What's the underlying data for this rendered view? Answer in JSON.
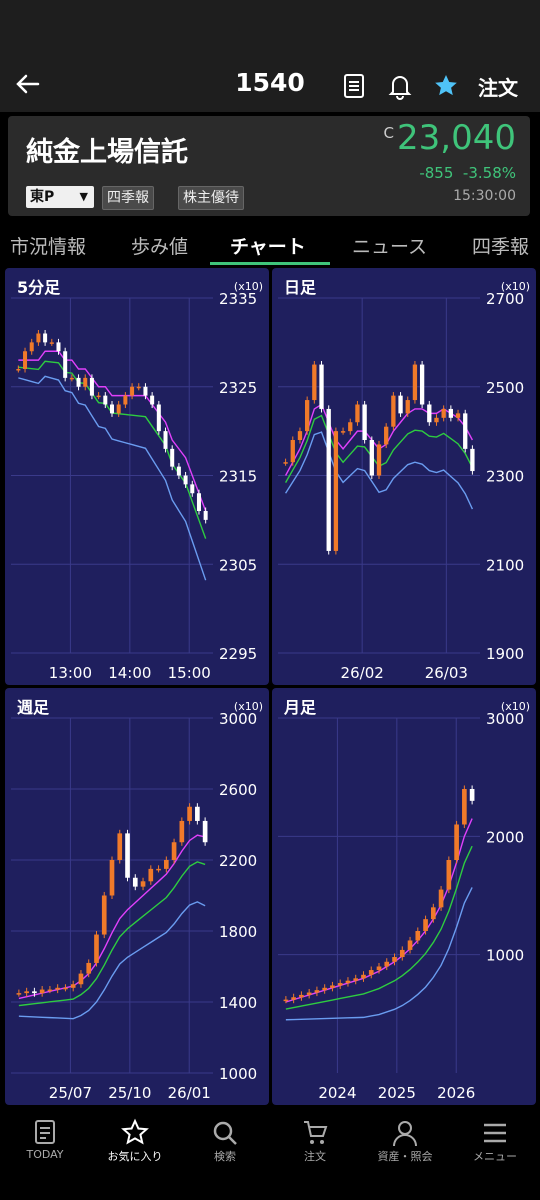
{
  "header": {
    "code": "1540",
    "order_label": "注文"
  },
  "stock": {
    "name": "純金上場信託",
    "price_mark": "C",
    "price": "23,040",
    "change": "-855",
    "change_pct": "-3.58%",
    "time": "15:30:00",
    "exchange": "東P",
    "tags": [
      "四季報",
      "株主優待"
    ]
  },
  "tabs": [
    "市況情報",
    "歩み値",
    "チャート",
    "ニュース",
    "四季報"
  ],
  "active_tab": 2,
  "colors": {
    "price_green": "#3fc47a",
    "panel_bg": "#1f1f5e",
    "candle_up": "#f07a2a",
    "candle_down": "#ffffff",
    "ma_short": "#e040fb",
    "ma_mid": "#2ecc40",
    "ma_long": "#6a9cf0"
  },
  "panels": [
    {
      "title": "5分足",
      "unit": "(x10)",
      "yticks": [
        "2335",
        "2325",
        "2315",
        "2305",
        "2295"
      ],
      "xticks": [
        "13:00",
        "14:00",
        "15:00"
      ]
    },
    {
      "title": "日足",
      "unit": "(x10)",
      "yticks": [
        "2700",
        "2500",
        "2300",
        "2100",
        "1900"
      ],
      "xticks": [
        "26/02",
        "26/03"
      ]
    },
    {
      "title": "週足",
      "unit": "(x10)",
      "yticks": [
        "3000",
        "2600",
        "2200",
        "1800",
        "1400",
        "1000"
      ],
      "xticks": [
        "25/07",
        "25/10",
        "26/01"
      ]
    },
    {
      "title": "月足",
      "unit": "(x10)",
      "yticks": [
        "3000",
        "2000",
        "1000"
      ],
      "xticks": [
        "2024",
        "2025",
        "2026"
      ]
    }
  ],
  "chart_data": [
    {
      "type": "candlestick",
      "title": "5分足",
      "ylim": [
        2295,
        2335
      ],
      "close": [
        2327,
        2329,
        2330,
        2331,
        2330,
        2330,
        2329,
        2326,
        2326,
        2325,
        2326,
        2324,
        2324,
        2323,
        2322,
        2323,
        2324,
        2325,
        2325,
        2324,
        2323,
        2320,
        2318,
        2316,
        2315,
        2314,
        2313,
        2311,
        2310
      ],
      "ma": [
        [
          2328,
          2328,
          2328,
          2328,
          2329,
          2329,
          2329,
          2328,
          2328,
          2327,
          2327,
          2326,
          2325,
          2325,
          2324,
          2324,
          2324,
          2324,
          2324,
          2324,
          2323,
          2322,
          2321,
          2319,
          2318,
          2317,
          2315,
          2313,
          2311
        ]
      ]
    },
    {
      "type": "candlestick",
      "title": "日足",
      "ylim": [
        1900,
        2700
      ],
      "close": [
        2330,
        2380,
        2400,
        2470,
        2550,
        2450,
        2130,
        2400,
        2400,
        2420,
        2460,
        2380,
        2300,
        2370,
        2410,
        2480,
        2440,
        2470,
        2550,
        2460,
        2420,
        2430,
        2450,
        2430,
        2440,
        2360,
        2310
      ],
      "ma": [
        [
          2300,
          2330,
          2360,
          2400,
          2450,
          2460,
          2420,
          2380,
          2360,
          2380,
          2400,
          2400,
          2380,
          2360,
          2370,
          2400,
          2420,
          2440,
          2450,
          2450,
          2440,
          2440,
          2450,
          2440,
          2430,
          2410,
          2380
        ]
      ]
    },
    {
      "type": "candlestick",
      "title": "週足",
      "ylim": [
        1000,
        3000
      ],
      "close": [
        1450,
        1460,
        1450,
        1470,
        1470,
        1480,
        1480,
        1500,
        1560,
        1620,
        1780,
        2000,
        2200,
        2350,
        2100,
        2050,
        2080,
        2150,
        2150,
        2200,
        2300,
        2420,
        2500,
        2420,
        2300
      ],
      "ma": [
        [
          1420,
          1430,
          1440,
          1450,
          1460,
          1470,
          1480,
          1490,
          1520,
          1560,
          1620,
          1700,
          1790,
          1870,
          1920,
          1960,
          2000,
          2040,
          2080,
          2120,
          2180,
          2250,
          2310,
          2340,
          2330
        ]
      ]
    },
    {
      "type": "candlestick",
      "title": "月足",
      "ylim": [
        0,
        3000
      ],
      "close": [
        620,
        640,
        660,
        680,
        700,
        720,
        740,
        760,
        780,
        800,
        830,
        870,
        900,
        940,
        980,
        1040,
        1120,
        1200,
        1300,
        1400,
        1550,
        1800,
        2100,
        2400,
        2300
      ],
      "ma": [
        [
          600,
          620,
          640,
          660,
          680,
          700,
          720,
          740,
          760,
          780,
          800,
          830,
          860,
          900,
          940,
          990,
          1050,
          1120,
          1200,
          1300,
          1420,
          1580,
          1780,
          2000,
          2150
        ]
      ]
    }
  ],
  "nav": [
    "TODAY",
    "お気に入り",
    "検索",
    "注文",
    "資産・照会",
    "メニュー"
  ],
  "nav_active": 1
}
